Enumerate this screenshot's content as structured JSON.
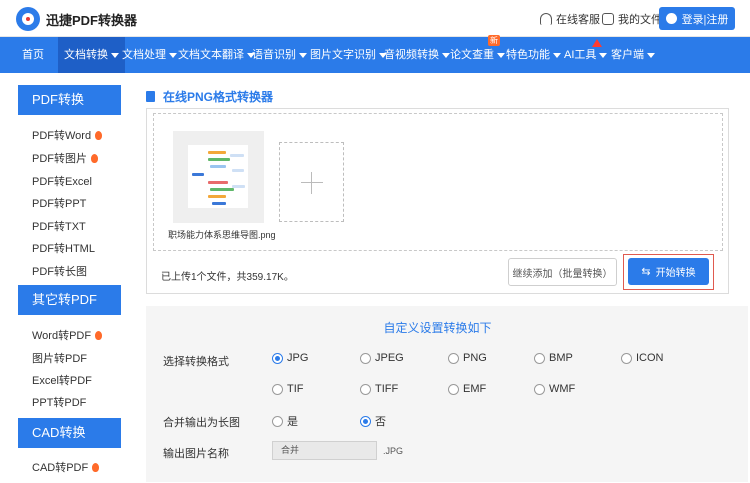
{
  "header": {
    "logo_text": "迅捷PDF转换器",
    "service_label": "在线客服",
    "files_label": "我的文件",
    "login_label": "登录|注册"
  },
  "nav": {
    "items": [
      {
        "label": "首页"
      },
      {
        "label": "文档转换"
      },
      {
        "label": "文档处理"
      },
      {
        "label": "文档文本翻译"
      },
      {
        "label": "语音识别"
      },
      {
        "label": "图片文字识别"
      },
      {
        "label": "音视频转换"
      },
      {
        "label": "论文查重",
        "badge": "新"
      },
      {
        "label": "特色功能"
      },
      {
        "label": "AI工具"
      },
      {
        "label": "客户端"
      }
    ],
    "active": "文档转换"
  },
  "sidebar": {
    "groups": [
      {
        "title": "PDF转换",
        "items": [
          "PDF转Word",
          "PDF转图片",
          "PDF转Excel",
          "PDF转PPT",
          "PDF转TXT",
          "PDF转HTML",
          "PDF转长图"
        ]
      },
      {
        "title": "其它转PDF",
        "items": [
          "Word转PDF",
          "图片转PDF",
          "Excel转PDF",
          "PPT转PDF"
        ]
      },
      {
        "title": "CAD转换",
        "items": [
          "CAD转PDF"
        ]
      }
    ],
    "hot_items": [
      "PDF转Word",
      "PDF转图片",
      "Word转PDF",
      "CAD转PDF"
    ]
  },
  "main": {
    "title": "在线PNG格式转换器",
    "file_name": "职场能力体系思维导图.png",
    "status": "已上传1个文件，共359.17K。",
    "continue_label": "继续添加（批量转换）",
    "start_label": "开始转换"
  },
  "settings": {
    "title": "自定义设置转换如下",
    "format_label": "选择转换格式",
    "formats": [
      "JPG",
      "JPEG",
      "PNG",
      "BMP",
      "ICON",
      "TIF",
      "TIFF",
      "EMF",
      "WMF"
    ],
    "selected_format": "JPG",
    "merge_label": "合并输出为长图",
    "merge_options": [
      "是",
      "否"
    ],
    "merge_selected": "否",
    "name_label": "输出图片名称",
    "name_value": "合并",
    "name_ext": ".JPG"
  },
  "colors": {
    "primary": "#2b7be9",
    "highlight_border": "#e05a4f",
    "hot": "#ff6a2a"
  }
}
